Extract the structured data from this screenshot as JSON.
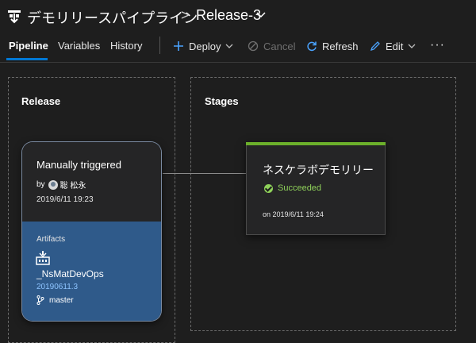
{
  "header": {
    "pipeline_name": "デモリリースパイプライン",
    "separator": ">",
    "release_name": "Release-3"
  },
  "tabs": [
    {
      "label": "Pipeline",
      "active": true
    },
    {
      "label": "Variables",
      "active": false
    },
    {
      "label": "History",
      "active": false
    }
  ],
  "commands": {
    "deploy": "Deploy",
    "cancel": "Cancel",
    "refresh": "Refresh",
    "edit": "Edit",
    "more": "···"
  },
  "release_panel": {
    "title": "Release",
    "card": {
      "trigger": "Manually triggered",
      "by_label": "by",
      "user": "聡 松永",
      "date": "2019/6/11 19:23",
      "artifacts_label": "Artifacts",
      "artifact_name": "_NsMatDevOps",
      "artifact_version": "20190611.3",
      "branch": "master"
    }
  },
  "stages_panel": {
    "title": "Stages",
    "stage": {
      "name": "ネスケラボデモリリー",
      "status": "Succeeded",
      "date": "on 2019/6/11 19:24",
      "status_color": "#8fd15a",
      "bar_color": "#6cb02b"
    }
  },
  "colors": {
    "accent": "#0078d4",
    "artifact_bg": "#2f5a8a",
    "link": "#8ec4ff"
  },
  "icons": {
    "pipeline": "pipeline-icon",
    "deploy": "plus-icon",
    "cancel": "cancel-icon",
    "refresh": "refresh-icon",
    "edit": "pencil-icon",
    "artifact": "build-artifact-icon",
    "branch": "git-branch-icon",
    "status": "check-circle-icon"
  }
}
